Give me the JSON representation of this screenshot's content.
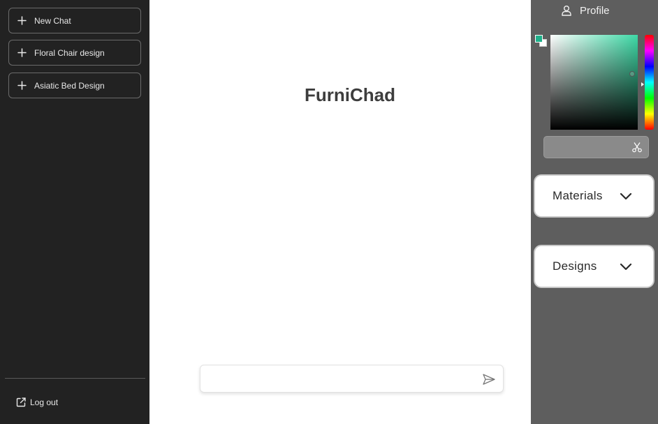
{
  "sidebar": {
    "chats": [
      {
        "label": "New Chat"
      },
      {
        "label": "Floral Chair design"
      },
      {
        "label": "Asiatic Bed Design"
      }
    ],
    "logout_label": "Log out"
  },
  "main": {
    "title": "FurniChad",
    "input_value": "",
    "input_placeholder": ""
  },
  "rightpanel": {
    "profile_label": "Profile",
    "color_picker": {
      "primary_color": "#1fb08a",
      "secondary_color": "#ffffff",
      "hue_color": "#3ed9a6",
      "hex_value": ""
    },
    "dropdowns": [
      {
        "label": "Materials"
      },
      {
        "label": "Designs"
      }
    ]
  },
  "colors": {
    "sidebar_bg": "#222222",
    "main_bg": "#ffffff",
    "panel_bg": "#5e5e5e",
    "title_text": "#3d3d3d"
  },
  "icons": {
    "new_chat": "plus-icon",
    "logout": "external-link-icon",
    "send": "send-icon",
    "profile": "user-icon",
    "eyedropper": "scissors-icon",
    "dropdown": "chevron-down-icon"
  }
}
